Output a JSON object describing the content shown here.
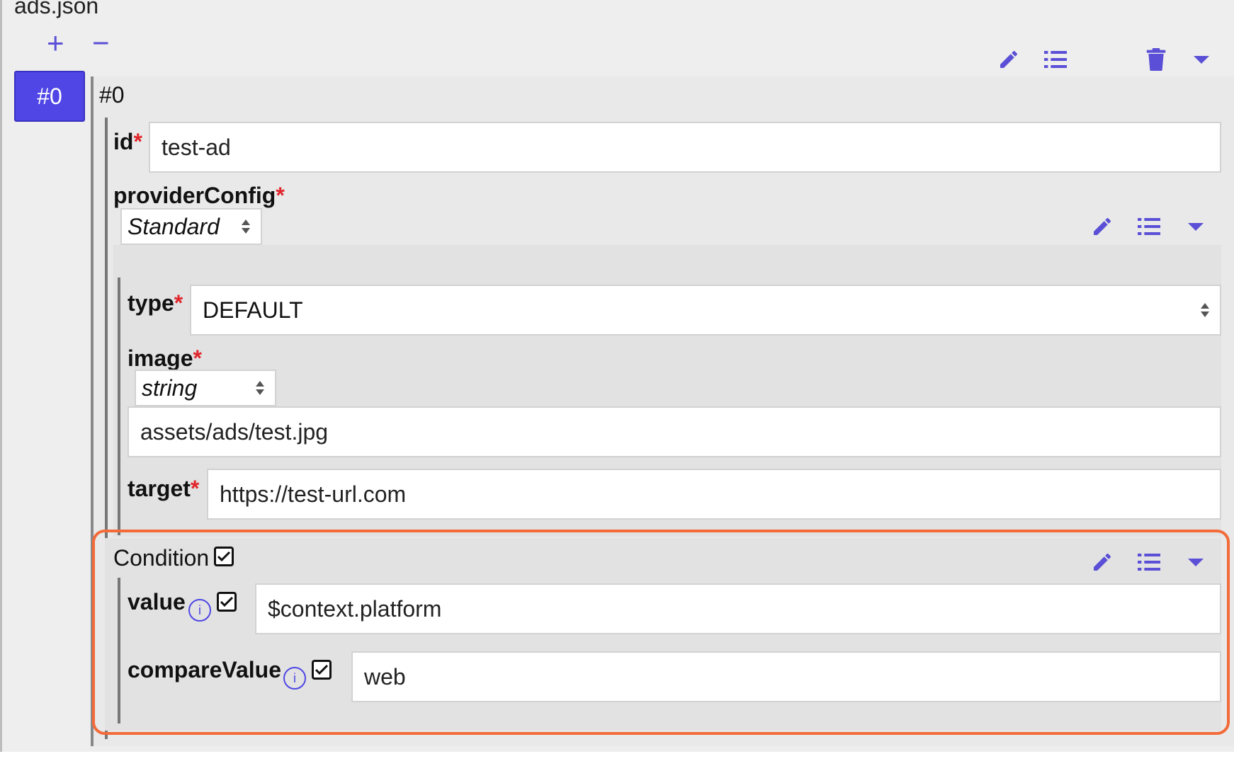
{
  "file": {
    "title": "ads.json"
  },
  "array_controls": {
    "add_label": "+",
    "remove_label": "−"
  },
  "tabs": [
    {
      "label": "#0",
      "active": true
    }
  ],
  "item": {
    "title": "#0",
    "id": {
      "label": "id",
      "value": "test-ad"
    },
    "providerConfig": {
      "label": "providerConfig",
      "selected": "Standard",
      "type": {
        "label": "type",
        "value": "DEFAULT"
      },
      "image": {
        "label": "image",
        "type_selected": "string",
        "value": "assets/ads/test.jpg"
      },
      "target": {
        "label": "target",
        "value": "https://test-url.com"
      }
    },
    "condition": {
      "label": "Condition",
      "checked": true,
      "value": {
        "label": "value",
        "value": "$context.platform",
        "checked": true
      },
      "compareValue": {
        "label": "compareValue",
        "value": "web",
        "checked": true
      }
    }
  },
  "required_mark": "*",
  "info_glyph": "i",
  "icons": {
    "edit": "pencil-icon",
    "properties": "list-icon",
    "delete": "trash-icon",
    "collapse": "caret-down-icon",
    "select": "updown-arrows-icon",
    "info": "info-icon",
    "checkbox": "checkbox-checked-icon"
  },
  "colors": {
    "accent": "#4f46e5",
    "required": "#e0262b",
    "highlight": "#f26b38",
    "panel": "#e9e9e9",
    "sub_panel": "#e2e2e2"
  }
}
